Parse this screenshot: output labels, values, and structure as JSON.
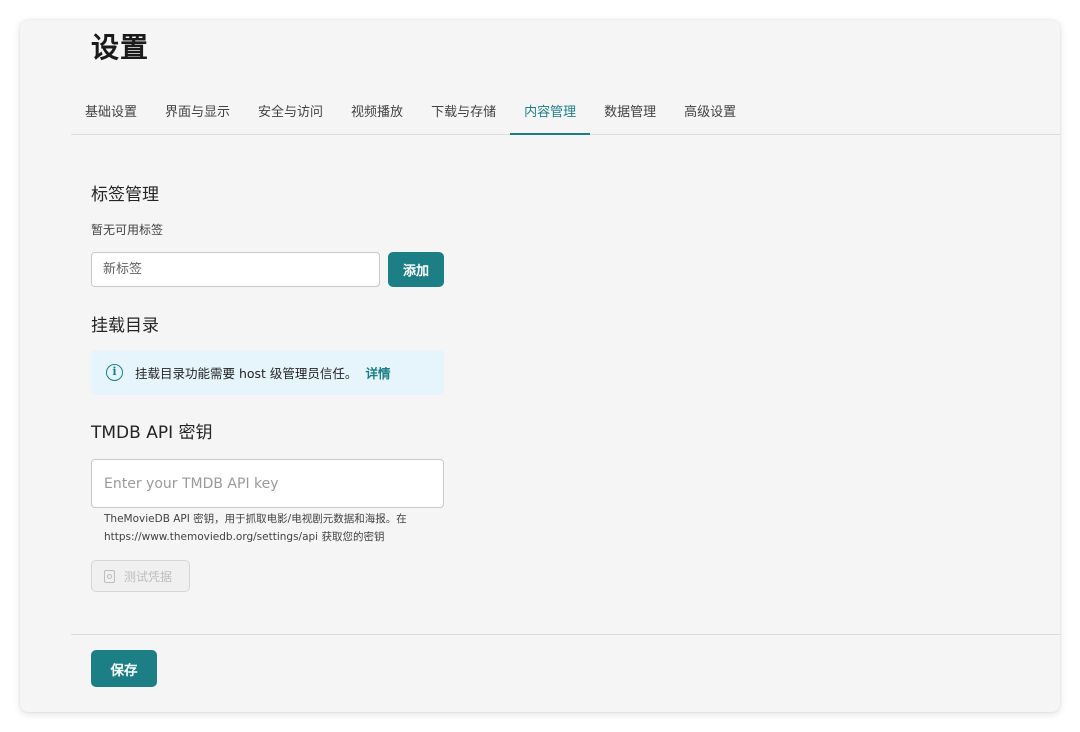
{
  "page": {
    "title": "设置"
  },
  "tabs": [
    {
      "label": "基础设置",
      "active": false
    },
    {
      "label": "界面与显示",
      "active": false
    },
    {
      "label": "安全与访问",
      "active": false
    },
    {
      "label": "视频播放",
      "active": false
    },
    {
      "label": "下载与存储",
      "active": false
    },
    {
      "label": "内容管理",
      "active": true
    },
    {
      "label": "数据管理",
      "active": false
    },
    {
      "label": "高级设置",
      "active": false
    }
  ],
  "tags": {
    "title": "标签管理",
    "empty_text": "暂无可用标签",
    "input_placeholder": "新标签",
    "add_label": "添加"
  },
  "mount": {
    "title": "挂载目录",
    "info_icon": "info-icon",
    "info_text": "挂载目录功能需要 host 级管理员信任。",
    "info_link": "详情"
  },
  "tmdb": {
    "title": "TMDB API 密钥",
    "input_placeholder": "Enter your TMDB API key",
    "help_line1": "TheMovieDB API 密钥，用于抓取电影/电视剧元数据和海报。在",
    "help_line2": "https://www.themoviedb.org/settings/api 获取您的密钥",
    "test_label": "测试凭据"
  },
  "footer": {
    "save_label": "保存"
  },
  "colors": {
    "accent": "#1d7f86",
    "info_bg": "#e6f4fb",
    "card_bg": "#f5f5f5"
  }
}
